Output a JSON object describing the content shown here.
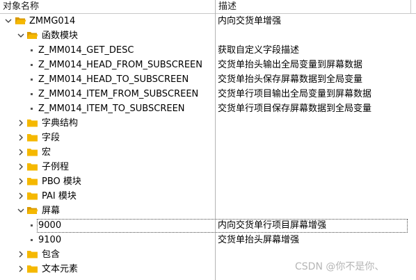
{
  "columns": {
    "name": "对象名称",
    "description": "描述"
  },
  "tree": {
    "root": {
      "label": "ZMMG014",
      "desc": "内向交货单增强"
    },
    "function_modules": {
      "label": "函数模块",
      "items": [
        {
          "label": "Z_MM014_GET_DESC",
          "desc": "获取自定义字段描述"
        },
        {
          "label": "Z_MM014_HEAD_FROM_SUBSCREEN",
          "desc": "交货单抬头输出全局变量到屏幕数据"
        },
        {
          "label": "Z_MM014_HEAD_TO_SUBSCREEN",
          "desc": "交货单抬头保存屏幕数据到全局变量"
        },
        {
          "label": "Z_MM014_ITEM_FROM_SUBSCREEN",
          "desc": "交货单行项目输出全局变量到屏幕数据"
        },
        {
          "label": "Z_MM014_ITEM_TO_SUBSCREEN",
          "desc": "交货单行项目保存屏幕数据到全局变量"
        }
      ]
    },
    "folders_a": [
      {
        "label": "字典结构"
      },
      {
        "label": "字段"
      },
      {
        "label": "宏"
      },
      {
        "label": "子例程"
      },
      {
        "label": "PBO 模块"
      },
      {
        "label": "PAI 模块"
      }
    ],
    "screens": {
      "label": "屏幕",
      "items": [
        {
          "label": "9000",
          "desc": "内向交货单行项目屏幕增强"
        },
        {
          "label": "9100",
          "desc": "交货单抬头屏幕增强"
        }
      ]
    },
    "folders_b": [
      {
        "label": "包含"
      },
      {
        "label": "文本元素"
      }
    ]
  },
  "watermark": "CSDN @你不是你、",
  "colors": {
    "folder": "#f5b800",
    "folder_dark": "#d99a00"
  }
}
